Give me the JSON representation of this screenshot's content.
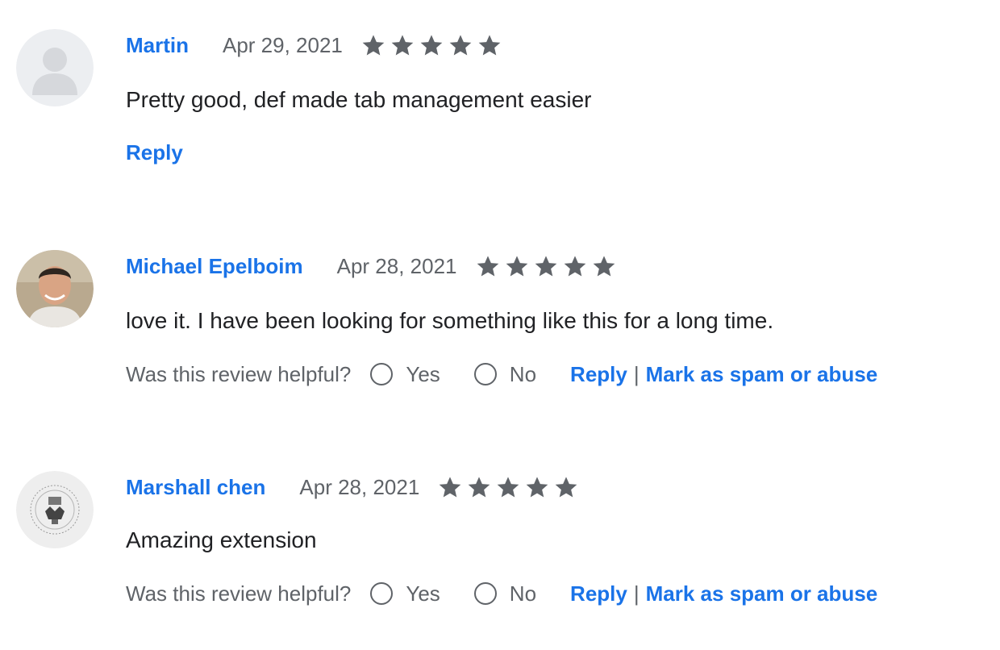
{
  "reviews": [
    {
      "author": "Martin",
      "date": "Apr 29, 2021",
      "rating": 5,
      "text": "Pretty good, def made tab management easier",
      "reply_label": "Reply"
    },
    {
      "author": "Michael Epelboim",
      "date": "Apr 28, 2021",
      "rating": 5,
      "text": "love it. I have been looking for something like this for a long time.",
      "helpful_question": "Was this review helpful?",
      "yes_label": "Yes",
      "no_label": "No",
      "reply_label": "Reply",
      "separator": "|",
      "spam_label": "Mark as spam or abuse"
    },
    {
      "author": "Marshall chen",
      "date": "Apr 28, 2021",
      "rating": 5,
      "text": "Amazing extension",
      "helpful_question": "Was this review helpful?",
      "yes_label": "Yes",
      "no_label": "No",
      "reply_label": "Reply",
      "separator": "|",
      "spam_label": "Mark as spam or abuse"
    }
  ],
  "colors": {
    "link": "#1a73e8",
    "muted": "#5f6368",
    "text": "#202124"
  }
}
